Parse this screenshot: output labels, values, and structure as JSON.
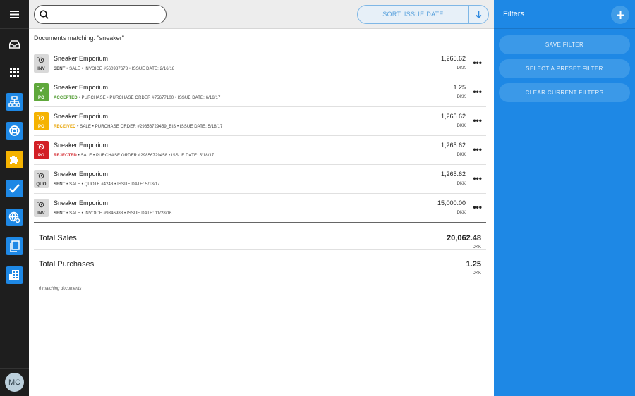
{
  "rail": {
    "menu_icon": "hamburger-icon",
    "inbox_icon": "inbox-tray-icon",
    "apps_icon": "grid-apps-icon",
    "apps": [
      {
        "icon": "org-chart-icon",
        "color": "#1e88e5"
      },
      {
        "icon": "lifebuoy-icon",
        "color": "#1e88e5"
      },
      {
        "icon": "puzzle-icon",
        "color": "#f5b301"
      },
      {
        "icon": "checkmark-icon",
        "color": "#1e88e5"
      },
      {
        "icon": "globe-gear-icon",
        "color": "#1e88e5"
      },
      {
        "icon": "documents-icon",
        "color": "#1e88e5"
      },
      {
        "icon": "building-icon",
        "color": "#1e88e5"
      }
    ],
    "avatar_initials": "MC"
  },
  "search": {
    "value": "",
    "placeholder": ""
  },
  "sort": {
    "label": "SORT: ISSUE DATE",
    "direction_icon": "arrow-down-icon"
  },
  "results": {
    "heading": "Documents matching: \"sneaker\"",
    "rows": [
      {
        "badge": "INV",
        "status": "SENT",
        "status_kind": "sent",
        "name": "Sneaker Emporium",
        "meta": " • SALE • INVOICE #560987678 • ISSUE DATE: 2/16/18",
        "amount": "1,265.62",
        "currency": "DKK"
      },
      {
        "badge": "PO",
        "status": "ACCEPTED",
        "status_kind": "accepted",
        "name": "Sneaker Emporium",
        "meta": " • PURCHASE • PURCHASE ORDER #75677100 • ISSUE DATE: 6/16/17",
        "amount": "1.25",
        "currency": "DKK"
      },
      {
        "badge": "PO",
        "status": "RECEIVED",
        "status_kind": "received",
        "name": "Sneaker Emporium",
        "meta": " • SALE • PURCHASE ORDER #29856729459_BIS • ISSUE DATE: 5/18/17",
        "amount": "1,265.62",
        "currency": "DKK"
      },
      {
        "badge": "PO",
        "status": "REJECTED",
        "status_kind": "rejected",
        "name": "Sneaker Emporium",
        "meta": " • SALE • PURCHASE ORDER #29856729458 • ISSUE DATE: 5/18/17",
        "amount": "1,265.62",
        "currency": "DKK"
      },
      {
        "badge": "QUO",
        "status": "SENT",
        "status_kind": "sent",
        "name": "Sneaker Emporium",
        "meta": " • SALE • QUOTE #4243 • ISSUE DATE: 5/18/17",
        "amount": "1,265.62",
        "currency": "DKK"
      },
      {
        "badge": "INV",
        "status": "SENT",
        "status_kind": "sent",
        "name": "Sneaker Emporium",
        "meta": " • SALE • INVOICE #9346983 • ISSUE DATE: 11/28/16",
        "amount": "15,000.00",
        "currency": "DKK"
      }
    ],
    "more_label": "•••"
  },
  "totals": [
    {
      "label": "Total Sales",
      "value": "20,062.48",
      "currency": "DKK"
    },
    {
      "label": "Total Purchases",
      "value": "1.25",
      "currency": "DKK"
    }
  ],
  "count_note": "6 matching documents",
  "filters": {
    "title": "Filters",
    "add_icon": "plus-icon",
    "buttons": [
      "SAVE FILTER",
      "SELECT A PRESET FILTER",
      "CLEAR CURRENT FILTERS"
    ]
  }
}
